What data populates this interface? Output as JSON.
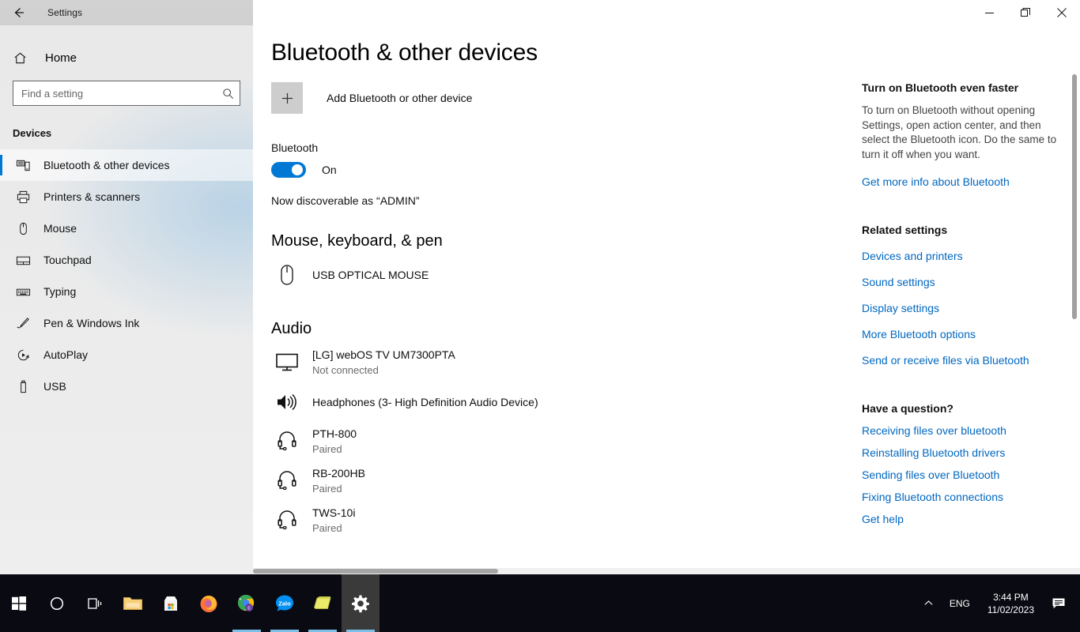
{
  "titlebar": {
    "back_icon": "back-arrow-icon",
    "app_title": "Settings",
    "minimize_label": "Minimize",
    "restore_label": "Restore",
    "close_label": "Close"
  },
  "sidebar": {
    "home_label": "Home",
    "home_icon": "home-icon",
    "search": {
      "placeholder": "Find a setting",
      "value": "",
      "icon": "search-icon"
    },
    "section_title": "Devices",
    "items": [
      {
        "label": "Bluetooth & other devices",
        "icon": "bluetooth-devices-icon",
        "active": true
      },
      {
        "label": "Printers & scanners",
        "icon": "printer-icon",
        "active": false
      },
      {
        "label": "Mouse",
        "icon": "mouse-icon",
        "active": false
      },
      {
        "label": "Touchpad",
        "icon": "touchpad-icon",
        "active": false
      },
      {
        "label": "Typing",
        "icon": "keyboard-icon",
        "active": false
      },
      {
        "label": "Pen & Windows Ink",
        "icon": "pen-icon",
        "active": false
      },
      {
        "label": "AutoPlay",
        "icon": "autoplay-icon",
        "active": false
      },
      {
        "label": "USB",
        "icon": "usb-icon",
        "active": false
      }
    ]
  },
  "main": {
    "page_title": "Bluetooth & other devices",
    "add_device": {
      "label": "Add Bluetooth or other device",
      "icon": "plus-icon"
    },
    "bluetooth": {
      "label": "Bluetooth",
      "toggle_state": "On",
      "toggle_on": true,
      "accent_color": "#0078d4",
      "discoverable_text": "Now discoverable as “ADMIN”"
    },
    "groups": [
      {
        "heading": "Mouse, keyboard, & pen",
        "devices": [
          {
            "name": "USB OPTICAL MOUSE",
            "status": "",
            "icon": "mouse-icon"
          }
        ]
      },
      {
        "heading": "Audio",
        "devices": [
          {
            "name": "[LG] webOS TV UM7300PTA",
            "status": "Not connected",
            "icon": "monitor-icon"
          },
          {
            "name": "Headphones (3- High Definition Audio Device)",
            "status": "",
            "icon": "speaker-icon"
          },
          {
            "name": "PTH-800",
            "status": "Paired",
            "icon": "headset-icon"
          },
          {
            "name": "RB-200HB",
            "status": "Paired",
            "icon": "headset-icon"
          },
          {
            "name": "TWS-10i",
            "status": "Paired",
            "icon": "headset-icon"
          }
        ]
      }
    ]
  },
  "right_panel": {
    "faster_heading": "Turn on Bluetooth even faster",
    "faster_body": "To turn on Bluetooth without opening Settings, open action center, and then select the Bluetooth icon. Do the same to turn it off when you want.",
    "faster_link": "Get more info about Bluetooth",
    "related_heading": "Related settings",
    "related_links": [
      "Devices and printers",
      "Sound settings",
      "Display settings",
      "More Bluetooth options",
      "Send or receive files via Bluetooth"
    ],
    "question_heading": "Have a question?",
    "question_links": [
      "Receiving files over bluetooth",
      "Reinstalling Bluetooth drivers",
      "Sending files over Bluetooth",
      "Fixing Bluetooth connections",
      "Get help"
    ],
    "link_color": "#0067c0"
  },
  "taskbar": {
    "items": [
      {
        "name": "start-button",
        "icon": "windows-logo-icon",
        "running": false,
        "active": false
      },
      {
        "name": "search-button",
        "icon": "circle-search-icon",
        "running": false,
        "active": false
      },
      {
        "name": "task-view-button",
        "icon": "task-view-icon",
        "running": false,
        "active": false
      },
      {
        "name": "file-explorer",
        "icon": "folder-icon",
        "running": false,
        "active": false
      },
      {
        "name": "microsoft-store",
        "icon": "store-icon",
        "running": false,
        "active": false
      },
      {
        "name": "firefox",
        "icon": "firefox-icon",
        "running": false,
        "active": false
      },
      {
        "name": "google-chrome",
        "icon": "chrome-icon",
        "running": true,
        "active": false
      },
      {
        "name": "zalo",
        "icon": "zalo-icon",
        "running": true,
        "active": false
      },
      {
        "name": "sticky-notes",
        "icon": "note-icon",
        "running": true,
        "active": false
      },
      {
        "name": "settings",
        "icon": "gear-icon",
        "running": true,
        "active": true
      }
    ],
    "tray": {
      "chevron_icon": "chevron-up-icon",
      "language": "ENG",
      "time": "3:44 PM",
      "date": "11/02/2023",
      "notification_icon": "notification-icon"
    }
  }
}
